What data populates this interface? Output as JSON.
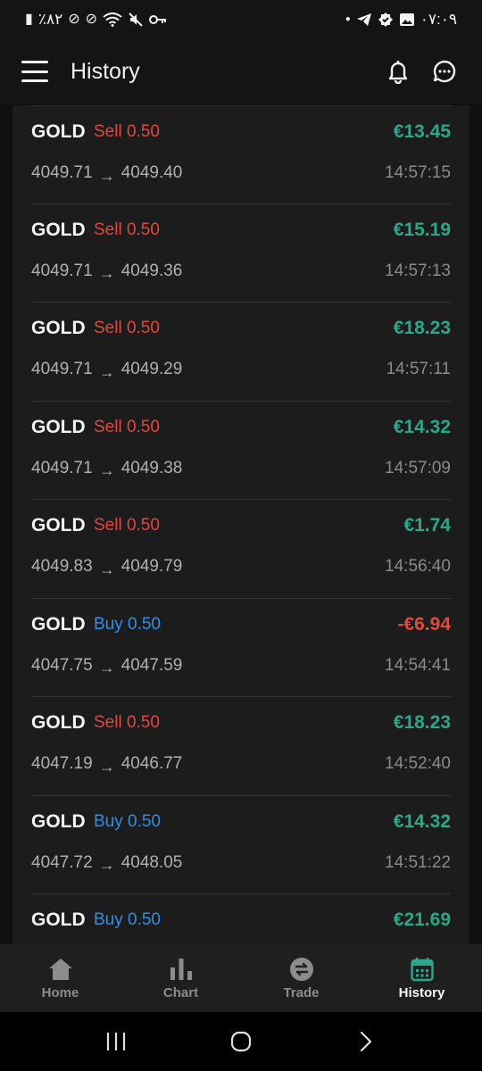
{
  "status_bar": {
    "time": "۰۷:۰۹",
    "battery": "٪۸۲"
  },
  "app_bar": {
    "title": "History"
  },
  "trades": [
    {
      "symbol": "GOLD",
      "side": "Sell",
      "lots": "Sell 0.50",
      "pnl": "€13.45",
      "open_price": "4049.71",
      "close_price": "4049.40",
      "time": "14:57:15"
    },
    {
      "symbol": "GOLD",
      "side": "Sell",
      "lots": "Sell 0.50",
      "pnl": "€15.19",
      "open_price": "4049.71",
      "close_price": "4049.36",
      "time": "14:57:13"
    },
    {
      "symbol": "GOLD",
      "side": "Sell",
      "lots": "Sell 0.50",
      "pnl": "€18.23",
      "open_price": "4049.71",
      "close_price": "4049.29",
      "time": "14:57:11"
    },
    {
      "symbol": "GOLD",
      "side": "Sell",
      "lots": "Sell 0.50",
      "pnl": "€14.32",
      "open_price": "4049.71",
      "close_price": "4049.38",
      "time": "14:57:09"
    },
    {
      "symbol": "GOLD",
      "side": "Sell",
      "lots": "Sell 0.50",
      "pnl": "€1.74",
      "open_price": "4049.83",
      "close_price": "4049.79",
      "time": "14:56:40"
    },
    {
      "symbol": "GOLD",
      "side": "Buy",
      "lots": "Buy 0.50",
      "pnl": "-€6.94",
      "open_price": "4047.75",
      "close_price": "4047.59",
      "time": "14:54:41"
    },
    {
      "symbol": "GOLD",
      "side": "Sell",
      "lots": "Sell 0.50",
      "pnl": "€18.23",
      "open_price": "4047.19",
      "close_price": "4046.77",
      "time": "14:52:40"
    },
    {
      "symbol": "GOLD",
      "side": "Buy",
      "lots": "Buy 0.50",
      "pnl": "€14.32",
      "open_price": "4047.72",
      "close_price": "4048.05",
      "time": "14:51:22"
    },
    {
      "symbol": "GOLD",
      "side": "Buy",
      "lots": "Buy 0.50",
      "pnl": "€21.69",
      "open_price": "",
      "close_price": "",
      "time": ""
    }
  ],
  "bottom_nav": {
    "home": "Home",
    "chart": "Chart",
    "trade": "Trade",
    "history": "History"
  },
  "colors": {
    "sell": "#e0473f",
    "buy": "#2f8fe6",
    "profit": "#2aa88a",
    "loss": "#e04a3f",
    "active_tab": "#2aa88a"
  }
}
